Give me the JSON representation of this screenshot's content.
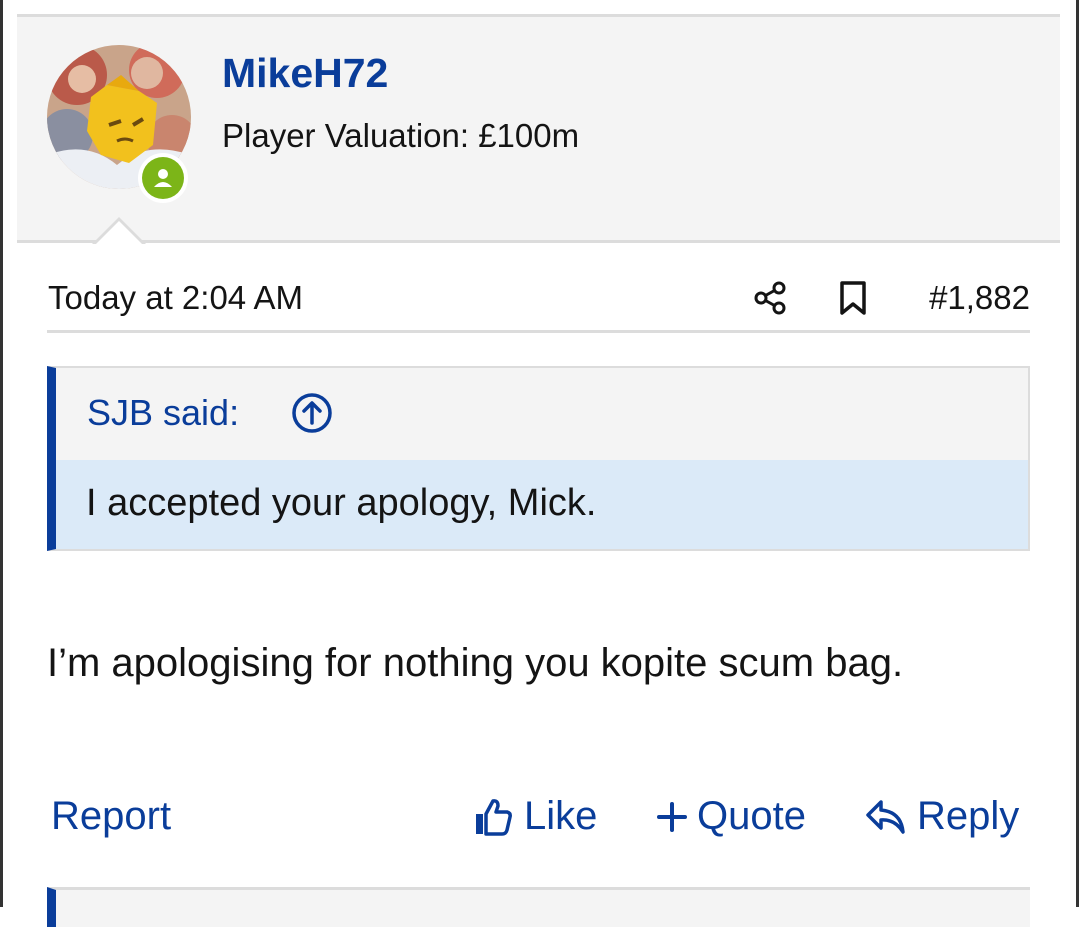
{
  "user": {
    "name": "MikeH72",
    "title": "Player Valuation: £100m",
    "avatar_icon": "avatar-image",
    "status_icon": "online-user-icon",
    "status_color": "#7cb518"
  },
  "post": {
    "date": "Today at 2:04 AM",
    "number": "#1,882",
    "share_icon": "share-icon",
    "bookmark_icon": "bookmark-icon"
  },
  "quote": {
    "author": "SJB said:",
    "jump_icon": "arrow-up-circle-icon",
    "text": "I accepted your apology, Mick."
  },
  "message": {
    "text": "I’m apologising for nothing you kopite scum bag."
  },
  "actions": {
    "report": "Report",
    "like": "Like",
    "quote": "Quote",
    "reply": "Reply"
  },
  "colors": {
    "accent": "#0a3d9a",
    "quote_body_bg": "#dbeaf8",
    "header_bg": "#f4f4f4"
  }
}
